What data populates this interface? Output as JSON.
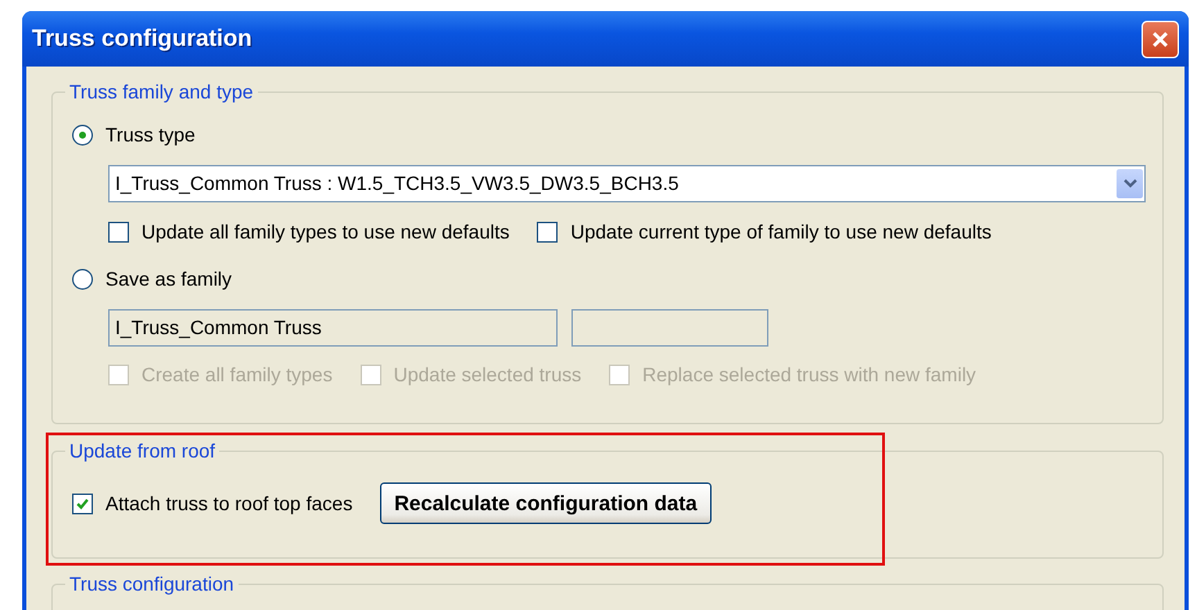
{
  "window": {
    "title": "Truss configuration"
  },
  "family_group": {
    "title": "Truss family and type",
    "truss_type": {
      "label": "Truss type",
      "selected": true,
      "dropdown": {
        "value": "I_Truss_Common Truss : W1.5_TCH3.5_VW3.5_DW3.5_BCH3.5"
      },
      "checkboxes": [
        {
          "label": "Update all family types to use new defaults",
          "checked": false,
          "disabled": false
        },
        {
          "label": "Update current type of family to use new defaults",
          "checked": false,
          "disabled": false
        }
      ]
    },
    "save_as_family": {
      "label": "Save as family",
      "selected": false,
      "name_field": {
        "value": "I_Truss_Common Truss",
        "disabled": true
      },
      "checkboxes": [
        {
          "label": "Create all family types",
          "checked": false,
          "disabled": true
        },
        {
          "label": "Update selected truss",
          "checked": false,
          "disabled": true
        },
        {
          "label": "Replace selected truss with new family",
          "checked": false,
          "disabled": true
        }
      ]
    }
  },
  "roof_group": {
    "title": "Update from roof",
    "highlighted": true,
    "checkbox": {
      "label": "Attach truss to roof top faces",
      "checked": true,
      "disabled": false
    },
    "button": {
      "label": "Recalculate configuration data"
    }
  },
  "config_group": {
    "title": "Truss configuration"
  }
}
